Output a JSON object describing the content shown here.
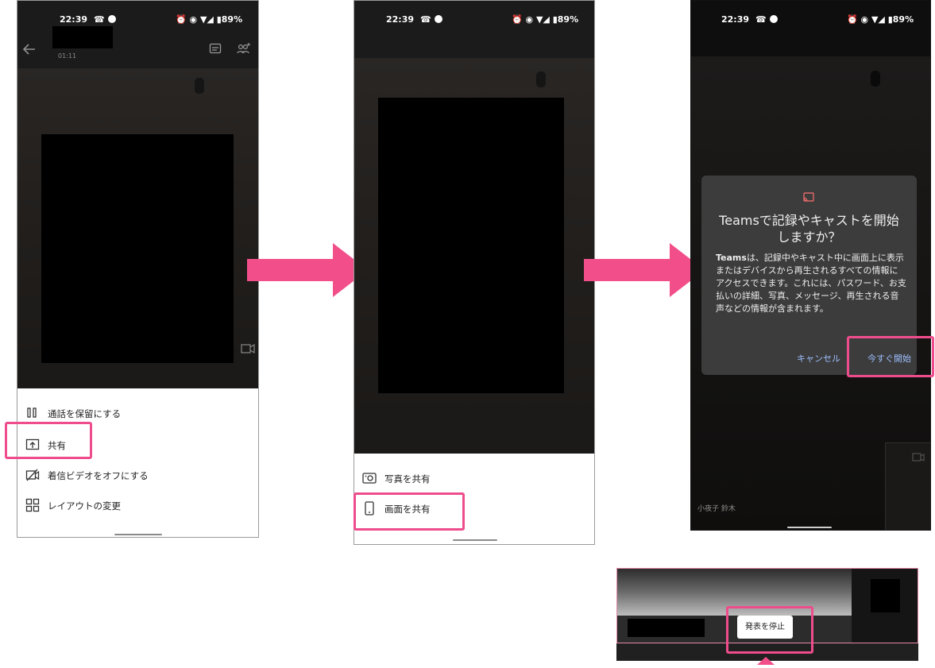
{
  "status_bar": {
    "time": "22:39",
    "battery": "89%",
    "icons": [
      "call-icon",
      "alarm-icon",
      "vibrate-icon",
      "wifi-icon",
      "signal-icon",
      "battery-icon"
    ]
  },
  "screen1": {
    "call_duration": "01:11",
    "menu": [
      {
        "icon": "pause-icon",
        "label": "通話を保留にする"
      },
      {
        "icon": "share-screen-icon",
        "label": "共有"
      },
      {
        "icon": "video-off-icon",
        "label": "着信ビデオをオフにする"
      },
      {
        "icon": "layout-grid-icon",
        "label": "レイアウトの変更"
      }
    ]
  },
  "screen2": {
    "menu": [
      {
        "icon": "photo-icon",
        "label": "写真を共有"
      },
      {
        "icon": "phone-icon",
        "label": "画面を共有"
      }
    ]
  },
  "screen3": {
    "dialog": {
      "icon": "cast-icon",
      "title_line1": "Teamsで記録やキャストを開始",
      "title_line2": "しますか？",
      "body_bold": "Teams",
      "body": "は、記録中やキャスト中に画面上に表示またはデバイスから再生されるすべての情報にアクセスできます。これには、パスワード、お支払いの詳細、写真、メッセージ、再生される音声などの情報が含まれます。",
      "cancel_label": "キャンセル",
      "start_label": "今すぐ開始"
    },
    "participant_name": "小夜子 鈴木"
  },
  "presentation": {
    "stop_label": "発表を停止"
  },
  "colors": {
    "highlight": "#ee4c8c",
    "arrow": "#f24f8a",
    "dialog_bg": "#3c3c3c",
    "dialog_button": "#9dbfff"
  }
}
